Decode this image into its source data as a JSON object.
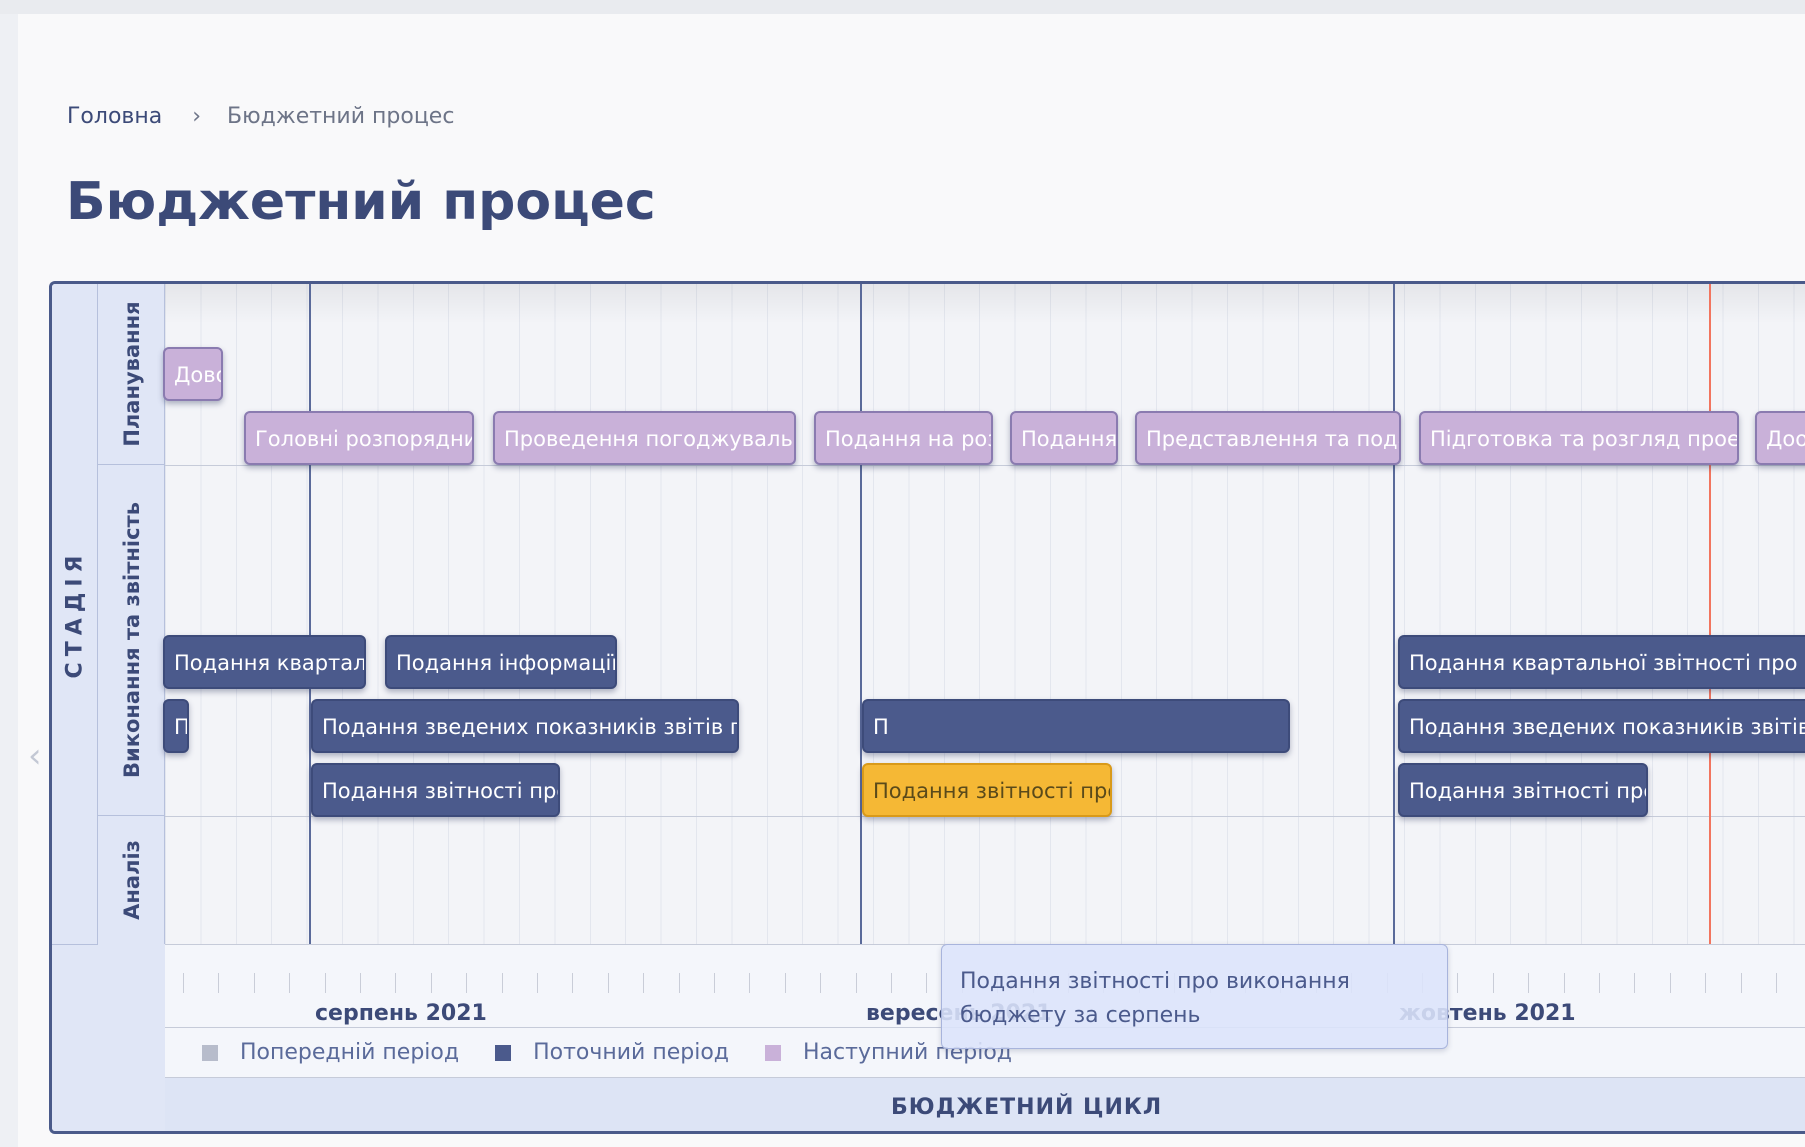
{
  "breadcrumb": {
    "home": "Головна",
    "separator": "›",
    "current": "Бюджетний процес"
  },
  "page_title": "Бюджетний процес",
  "gantt": {
    "stage_label": "СТАДІЯ",
    "rows": [
      {
        "label": "Планування"
      },
      {
        "label": "Виконання та звітність"
      },
      {
        "label": "Аналіз"
      }
    ],
    "months": [
      "серпень 2021",
      "вересень 2021",
      "жовтень 2021"
    ],
    "legend": [
      {
        "label": "Попередній період",
        "color": "#b7bccb"
      },
      {
        "label": "Поточний період",
        "color": "#4b5a8c"
      },
      {
        "label": "Наступний період",
        "color": "#c9b1d9"
      }
    ],
    "axis_title": "БЮДЖЕТНИЙ ЦИКЛ",
    "tasks": [
      {
        "label": "Дово",
        "period": "next"
      },
      {
        "label": "Головні розпорядни",
        "period": "next"
      },
      {
        "label": "Проведення погоджувальн",
        "period": "next"
      },
      {
        "label": "Подання на роз",
        "period": "next"
      },
      {
        "label": "Подання",
        "period": "next"
      },
      {
        "label": "Представлення та подан",
        "period": "next"
      },
      {
        "label": "Підготовка та розгляд проек",
        "period": "next"
      },
      {
        "label": "Доо",
        "period": "next"
      },
      {
        "label": "Подання квартал",
        "period": "current"
      },
      {
        "label": "Подання інформації",
        "period": "current"
      },
      {
        "label": "Подання квартальної звітності про в",
        "period": "current"
      },
      {
        "label": "П",
        "period": "current"
      },
      {
        "label": "Подання зведених показників звітів пр",
        "period": "current"
      },
      {
        "label": "П",
        "period": "current"
      },
      {
        "label": "Подання зведених показників звітів",
        "period": "current"
      },
      {
        "label": "Подання звітності про",
        "period": "current"
      },
      {
        "label": "Подання звітності про",
        "period": "highlight"
      },
      {
        "label": "Подання звітності про",
        "period": "current"
      }
    ],
    "tooltip": {
      "line1": "Подання звітності про виконання",
      "line2": "бюджету за серпень"
    }
  }
}
